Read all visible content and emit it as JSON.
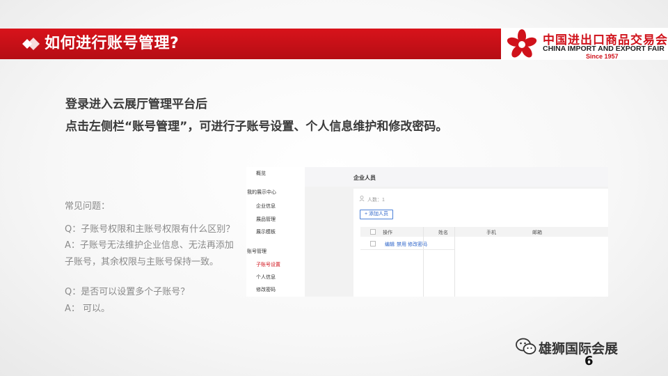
{
  "header": {
    "title": "如何进行账号管理?",
    "brand_color": "#d0121b"
  },
  "logo": {
    "cn": "中国进出口商品交易会",
    "en": "CHINA IMPORT AND EXPORT FAIR",
    "since": "Since 1957"
  },
  "intro": [
    "登录进入云展厅管理平台后",
    "点击左侧栏“账号管理”，可进行子账号设置、个人信息维护和修改密码。"
  ],
  "faq": {
    "heading": "常见问题：",
    "lines": [
      "Q：子账号权限和主账号权限有什么区别？",
      "A：子账号无法维护企业信息、无法再添加",
      "子账号，其余权限与主账号保持一致。",
      "Q：是否可以设置多个子账号？",
      "A： 可以。"
    ]
  },
  "screenshot": {
    "sidebar": {
      "overview": "概览",
      "section1": "我的展示中心",
      "items1": [
        "企业信息",
        "展品管理",
        "展示模板"
      ],
      "section2": "账号管理",
      "items2": [
        "子账号设置",
        "个人信息",
        "修改密码"
      ],
      "active_color": "#d0121b"
    },
    "page_title": "企业人员",
    "count": "人数：1",
    "add_button": "+ 添加人员",
    "columns": [
      "操作",
      "姓名",
      "手机",
      "邮箱"
    ],
    "row_actions": [
      "编辑",
      "禁用",
      "修改密码"
    ]
  },
  "watermark": "雄狮国际会展",
  "page_number": "6"
}
